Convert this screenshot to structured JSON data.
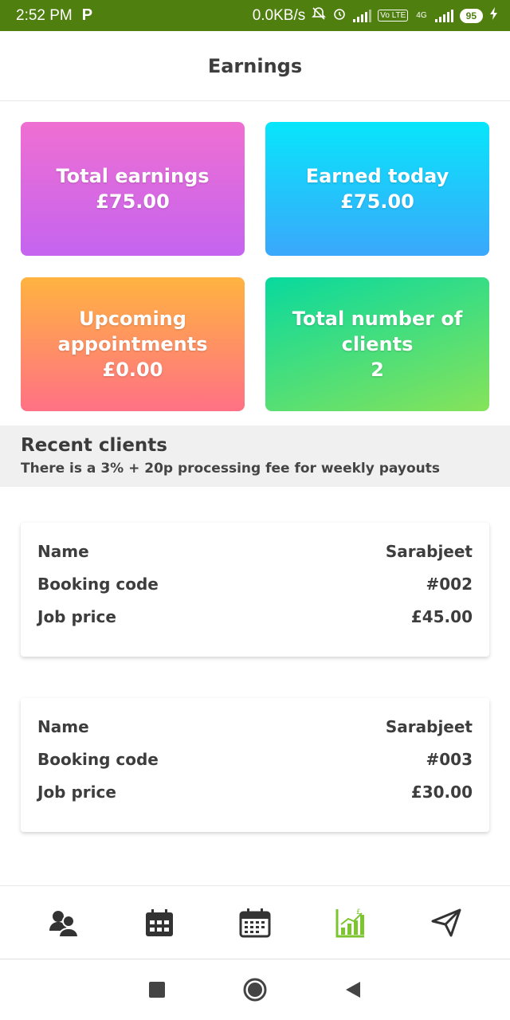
{
  "status_bar": {
    "time": "2:52 PM",
    "p_icon": "P",
    "net_speed": "0.0KB/s",
    "volte": "Vo LTE",
    "network": "4G",
    "battery": "95"
  },
  "header": {
    "title": "Earnings"
  },
  "tiles": [
    {
      "label": "Total earnings",
      "value": "£75.00"
    },
    {
      "label": "Earned today",
      "value": "£75.00"
    },
    {
      "label": "Upcoming appointments",
      "value": "£0.00"
    },
    {
      "label": "Total number of clients",
      "value": "2"
    }
  ],
  "recent": {
    "title": "Recent clients",
    "note": "There is a 3% + 20p processing fee for weekly payouts"
  },
  "clients": [
    {
      "name_label": "Name",
      "name": "Sarabjeet",
      "code_label": "Booking code",
      "code": "#002",
      "price_label": "Job price",
      "price": "£45.00"
    },
    {
      "name_label": "Name",
      "name": "Sarabjeet",
      "code_label": "Booking code",
      "code": "#003",
      "price_label": "Job price",
      "price": "£30.00"
    }
  ],
  "bottom_nav": {
    "items": [
      "clients-icon",
      "calendar-grid-icon",
      "calendar-icon",
      "earnings-chart-icon",
      "send-icon"
    ],
    "active_index": 3,
    "active_color": "#7cc52f",
    "inactive_color": "#333333"
  },
  "system_nav": [
    "recents-square-icon",
    "home-circle-icon",
    "back-triangle-icon"
  ]
}
